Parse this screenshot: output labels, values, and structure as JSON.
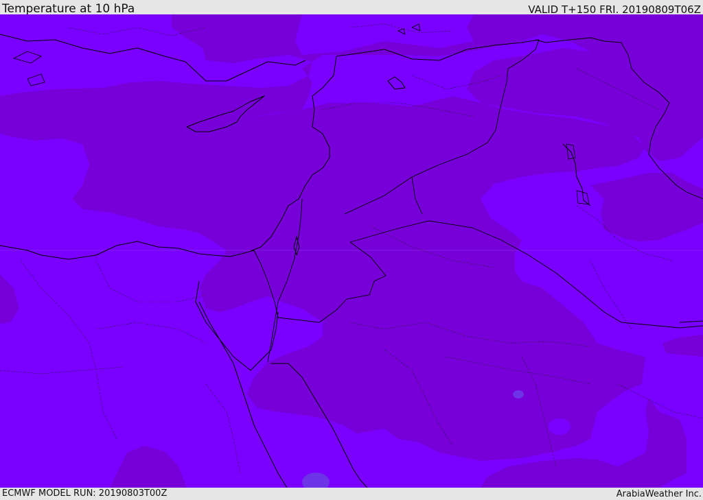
{
  "header": {
    "title": "Temperature at 10 hPa",
    "valid_time": "VALID T+150 FRI. 20190809T06Z"
  },
  "footer": {
    "model_run": "ECMWF MODEL RUN: 20190803T00Z",
    "credit": "ArabiaWeather Inc."
  },
  "map": {
    "field": "temperature",
    "level": "10 hPa",
    "colors": {
      "warmer_band": "#7a00ff",
      "cooler_band": "#7700d9",
      "cold_spot": "#6d33e6",
      "coastline": "#000000",
      "border": "#1a1a1a"
    }
  }
}
